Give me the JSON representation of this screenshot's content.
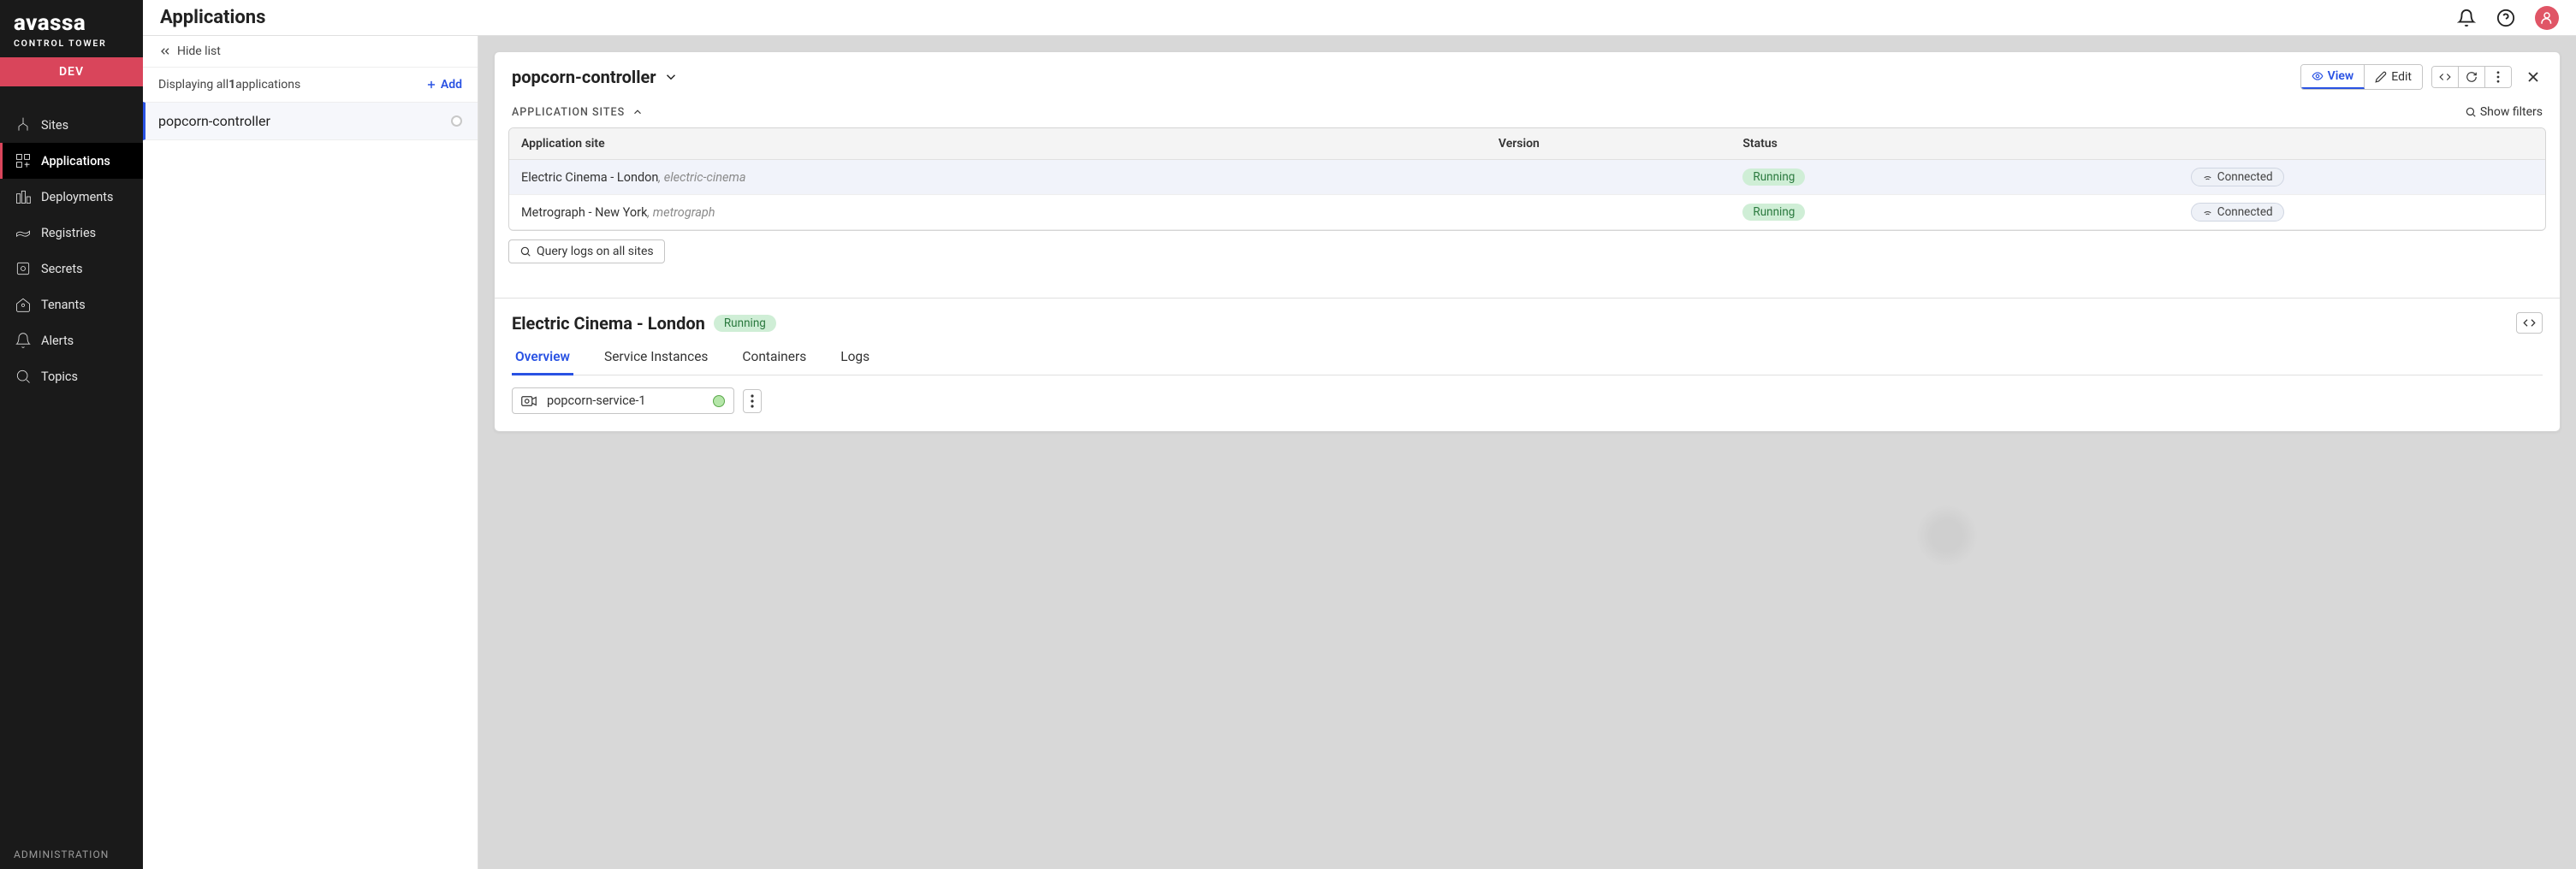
{
  "brand": {
    "name": "avassa",
    "subtitle": "CONTROL TOWER"
  },
  "env": "DEV",
  "sidebar": {
    "items": [
      {
        "label": "Sites"
      },
      {
        "label": "Applications"
      },
      {
        "label": "Deployments"
      },
      {
        "label": "Registries"
      },
      {
        "label": "Secrets"
      },
      {
        "label": "Tenants"
      },
      {
        "label": "Alerts"
      },
      {
        "label": "Topics"
      }
    ],
    "admin_label": "ADMINISTRATION"
  },
  "page_title": "Applications",
  "list_panel": {
    "hide_label": "Hide list",
    "displaying_prefix": "Displaying all ",
    "count": "1",
    "displaying_suffix": " applications",
    "add_label": "Add",
    "items": [
      {
        "name": "popcorn-controller"
      }
    ]
  },
  "detail": {
    "title": "popcorn-controller",
    "view_label": "View",
    "edit_label": "Edit",
    "section_label": "APPLICATION SITES",
    "show_filters": "Show filters",
    "columns": {
      "site": "Application site",
      "version": "Version",
      "status": "Status"
    },
    "rows": [
      {
        "name": "Electric Cinema - London",
        "slug": "electric-cinema",
        "version": "",
        "status": "Running",
        "conn": "Connected"
      },
      {
        "name": "Metrograph - New York",
        "slug": "metrograph",
        "version": "",
        "status": "Running",
        "conn": "Connected"
      }
    ],
    "query_logs": "Query logs on all sites"
  },
  "site_detail": {
    "title": "Electric Cinema - London",
    "status": "Running",
    "tabs": [
      {
        "label": "Overview"
      },
      {
        "label": "Service Instances"
      },
      {
        "label": "Containers"
      },
      {
        "label": "Logs"
      }
    ],
    "service": "popcorn-service-1"
  }
}
